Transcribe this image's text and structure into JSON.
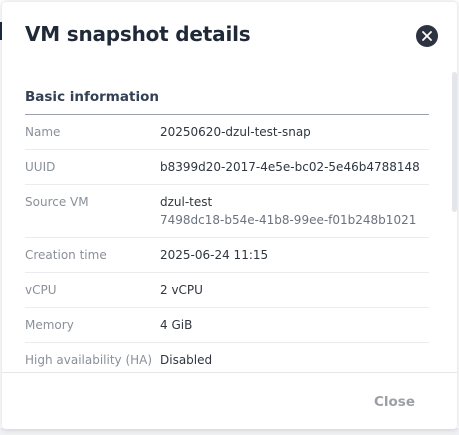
{
  "dialog": {
    "title": "VM snapshot details",
    "close_button": "Close"
  },
  "basic_information": {
    "heading": "Basic information",
    "rows": [
      {
        "label": "Name",
        "value": "20250620-dzul-test-snap"
      },
      {
        "label": "UUID",
        "value": "b8399d20-2017-4e5e-bc02-5e46b4788148"
      },
      {
        "label": "Source VM",
        "value": "dzul-test",
        "subvalue": "7498dc18-b54e-41b8-99ee-f01b248b1021"
      },
      {
        "label": "Creation time",
        "value": "2025-06-24 11:15"
      },
      {
        "label": "vCPU",
        "value": "2 vCPU"
      },
      {
        "label": "Memory",
        "value": "4 GiB"
      },
      {
        "label": "High availability (HA)",
        "value": "Disabled"
      }
    ]
  },
  "icons": {
    "close": "close-icon"
  }
}
